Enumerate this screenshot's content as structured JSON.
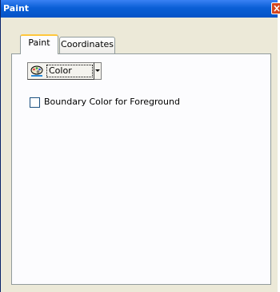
{
  "window": {
    "title": "Paint"
  },
  "tabs": [
    {
      "label": "Paint",
      "active": true
    },
    {
      "label": "Coordinates",
      "active": false
    }
  ],
  "paint_tab": {
    "color_button_label": "Color",
    "color_button_icon": "palette-icon",
    "boundary_checkbox": {
      "label": "Boundary Color for Foreground",
      "checked": false
    }
  },
  "colors": {
    "titlebar": "#0a5fd6",
    "active_tab_accent": "#ffc73c",
    "close_button": "#d7451c"
  }
}
